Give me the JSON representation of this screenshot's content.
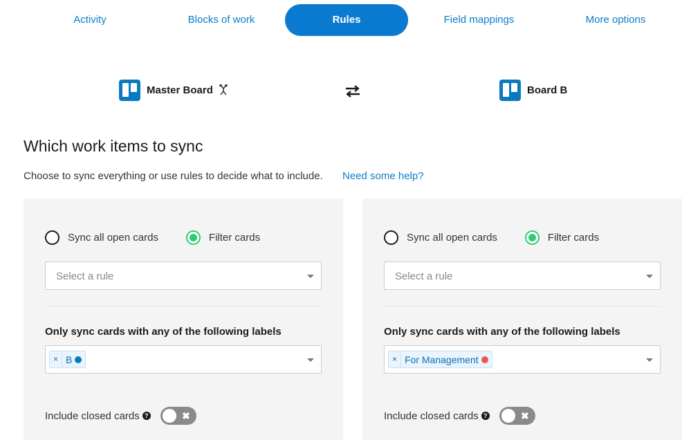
{
  "tabs": [
    {
      "label": "Activity"
    },
    {
      "label": "Blocks of work"
    },
    {
      "label": "Rules"
    },
    {
      "label": "Field mappings"
    },
    {
      "label": "More options"
    }
  ],
  "active_tab": "Rules",
  "boards": {
    "left": {
      "name": "Master Board",
      "icon": "trello-board-icon",
      "badge_icon": "merge-icon"
    },
    "swap_icon": "swap-arrows-icon",
    "right": {
      "name": "Board B",
      "icon": "trello-board-icon"
    }
  },
  "section": {
    "title": "Which work items to sync",
    "description": "Choose to sync everything or use rules to decide what to include.",
    "help_link": "Need some help?"
  },
  "panels": {
    "left": {
      "radio_all": "Sync all open cards",
      "radio_filter": "Filter cards",
      "selected_option": "Filter cards",
      "rule_placeholder": "Select a rule",
      "labels_title": "Only sync cards with any of the following labels",
      "chip": {
        "remove": "×",
        "label": "B",
        "color": "#0a79bf"
      },
      "closed_label": "Include closed cards",
      "closed_toggle_state": "off",
      "toggle_x": "✖"
    },
    "right": {
      "radio_all": "Sync all open cards",
      "radio_filter": "Filter cards",
      "selected_option": "Filter cards",
      "rule_placeholder": "Select a rule",
      "labels_title": "Only sync cards with any of the following labels",
      "chip": {
        "remove": "×",
        "label": "For Management",
        "color": "#eb5a46"
      },
      "closed_label": "Include closed cards",
      "closed_toggle_state": "off",
      "toggle_x": "✖"
    }
  },
  "help_icon_glyph": "?",
  "colors": {
    "accent": "#0a7bd1",
    "link": "#0b7dc7",
    "radio_checked": "#2ecc71",
    "panel_bg": "#f4f4f4",
    "toggle_off": "#8a8a8a"
  }
}
